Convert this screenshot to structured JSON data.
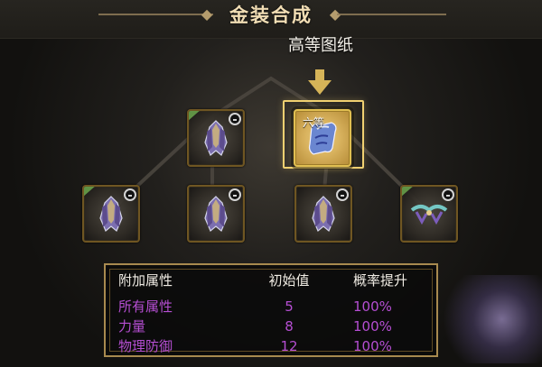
{
  "title": "金装合成",
  "top_label": "高等图纸",
  "selected_slot_badge": "六等",
  "stats": {
    "headers": [
      "附加属性",
      "初始值",
      "概率提升"
    ],
    "rows": [
      {
        "name": "所有属性",
        "value": "5",
        "probability": "100%"
      },
      {
        "name": "力量",
        "value": "8",
        "probability": "100%"
      },
      {
        "name": "物理防御",
        "value": "12",
        "probability": "100%"
      }
    ]
  },
  "colors": {
    "gold": "#e1bf51",
    "purple": "#b54ed2",
    "title": "#f1ddb4"
  }
}
